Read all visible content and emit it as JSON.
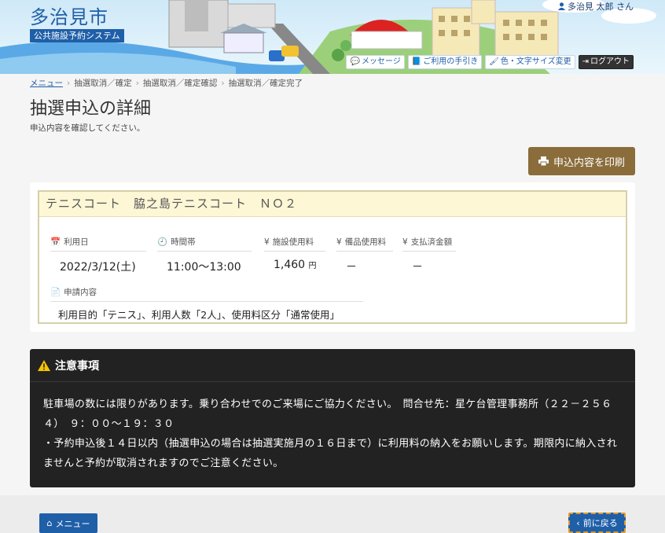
{
  "header": {
    "city_name": "多治見市",
    "system_name": "公共施設予約システム",
    "user_name": "多治見 太郎 さん",
    "buttons": {
      "messages": "メッセージ",
      "guide": "ご利用の手引き",
      "color_text": "色・文字サイズ変更",
      "logout": "ログアウト"
    }
  },
  "breadcrumb": [
    "メニュー",
    "抽選取消／確定",
    "抽選取消／確定確認",
    "抽選取消／確定完了"
  ],
  "page": {
    "title": "抽選申込の詳細",
    "subtitle": "申込内容を確認してください。",
    "print_label": "申込内容を印刷"
  },
  "detail": {
    "facility": "テニスコート　脇之島テニスコート　ＮＯ２",
    "date_label": "利用日",
    "date_value": "2022/3/12(土)",
    "time_label": "時間帯",
    "time_value": "11:00〜13:00",
    "fee_label": "施設使用料",
    "fee_value": "1,460",
    "fee_unit": "円",
    "equip_label": "備品使用料",
    "equip_value": "－",
    "paid_label": "支払済金額",
    "paid_value": "－",
    "apply_label": "申請内容",
    "apply_value": "利用目的「テニス」、利用人数「2人」、使用料区分「通常使用」"
  },
  "notice": {
    "title": "注意事項",
    "line1": "駐車場の数には限りがあります。乗り合わせでのご来場にご協力ください。　問合せ先：星ケ台管理事務所（２２－２５６４）　９：００～１９：３０",
    "line2": "・予約申込後１４日以内（抽選申込の場合は抽選実施月の１６日まで）に利用料の納入をお願いします。期限内に納入されませんと予約が取消されますのでご注意ください。"
  },
  "footer": {
    "menu_label": "メニュー",
    "back_label": "前に戻る"
  }
}
